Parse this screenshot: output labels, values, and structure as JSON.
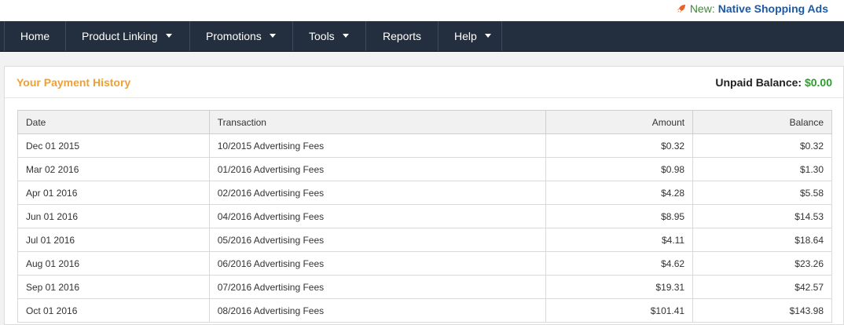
{
  "promo": {
    "new_label": "New:",
    "link_label": "Native Shopping Ads"
  },
  "nav": [
    {
      "label": "Home",
      "dropdown": false
    },
    {
      "label": "Product Linking",
      "dropdown": true
    },
    {
      "label": "Promotions",
      "dropdown": true
    },
    {
      "label": "Tools",
      "dropdown": true
    },
    {
      "label": "Reports",
      "dropdown": false
    },
    {
      "label": "Help",
      "dropdown": true
    }
  ],
  "panel": {
    "title": "Your Payment History",
    "unpaid_label": "Unpaid Balance:",
    "unpaid_amount": "$0.00"
  },
  "table": {
    "headers": [
      "Date",
      "Transaction",
      "Amount",
      "Balance"
    ],
    "rows": [
      [
        "Dec 01 2015",
        "10/2015 Advertising Fees",
        "$0.32",
        "$0.32"
      ],
      [
        "Mar 02 2016",
        "01/2016 Advertising Fees",
        "$0.98",
        "$1.30"
      ],
      [
        "Apr 01 2016",
        "02/2016 Advertising Fees",
        "$4.28",
        "$5.58"
      ],
      [
        "Jun 01 2016",
        "04/2016 Advertising Fees",
        "$8.95",
        "$14.53"
      ],
      [
        "Jul 01 2016",
        "05/2016 Advertising Fees",
        "$4.11",
        "$18.64"
      ],
      [
        "Aug 01 2016",
        "06/2016 Advertising Fees",
        "$4.62",
        "$23.26"
      ],
      [
        "Sep 01 2016",
        "07/2016 Advertising Fees",
        "$19.31",
        "$42.57"
      ],
      [
        "Oct 01 2016",
        "08/2016 Advertising Fees",
        "$101.41",
        "$143.98"
      ]
    ]
  },
  "colors": {
    "nav_bg": "#232f3e",
    "title_orange": "#f0a030",
    "balance_green": "#2aa02a",
    "promo_link_blue": "#1a5aa8"
  },
  "icons": [
    "rocket-icon",
    "caret-down-icon"
  ]
}
